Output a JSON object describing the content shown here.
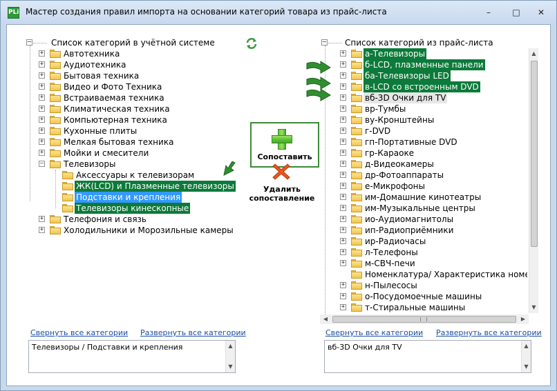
{
  "window": {
    "app_icon": "PLi",
    "title": "Мастер создания правил импорта на основании категорий товара из прайс-листа",
    "controls": {
      "minimize": "–",
      "maximize": "□",
      "close": "✕"
    }
  },
  "left_tree": {
    "root_label": "Список категорий в учётной системе",
    "items": [
      {
        "label": "Автотехника",
        "expander": "+"
      },
      {
        "label": "Аудиотехника",
        "expander": "+"
      },
      {
        "label": "Бытовая техника",
        "expander": "+"
      },
      {
        "label": "Видео и Фото Техника",
        "expander": "+"
      },
      {
        "label": "Встраиваемая техника",
        "expander": "+"
      },
      {
        "label": "Климатическая техника",
        "expander": "+"
      },
      {
        "label": "Компьютерная техника",
        "expander": "+"
      },
      {
        "label": "Кухонные плиты",
        "expander": "+"
      },
      {
        "label": "Мелкая бытовая техника",
        "expander": "+"
      },
      {
        "label": "Мойки и смесители",
        "expander": "+"
      },
      {
        "label": "Телевизоры",
        "expander": "–"
      },
      {
        "label": "Телефония и связь",
        "expander": "+"
      },
      {
        "label": "Холодильники и Морозильные камеры",
        "expander": "+"
      }
    ],
    "children": [
      {
        "label": "Аксессуары к телевизорам",
        "state": "normal"
      },
      {
        "label": "ЖК(LCD) и Плазменные телевизоры",
        "state": "green"
      },
      {
        "label": "Подставки и крепления",
        "state": "blue"
      },
      {
        "label": "Телевизоры кинескопные",
        "state": "green"
      }
    ],
    "collapse_link": "Свернуть все категории",
    "expand_link": "Развернуть все категории",
    "selected_path": "Телевизоры / Подставки и крепления"
  },
  "right_tree": {
    "root_label": "Список категорий из прайс-листа",
    "items": [
      {
        "label": "а-Телевизоры",
        "state": "green",
        "expander": "+"
      },
      {
        "label": "б-LCD, плазменные панели",
        "state": "green",
        "expander": "+"
      },
      {
        "label": "ба-Телевизоры LED",
        "state": "green",
        "expander": "+"
      },
      {
        "label": "в-LCD со встроенным DVD",
        "state": "green",
        "expander": "+"
      },
      {
        "label": "вб-3D Очки для TV",
        "state": "gray",
        "expander": "+"
      },
      {
        "label": "вр-Тумбы",
        "state": "normal",
        "expander": "+"
      },
      {
        "label": "ву-Кронштейны",
        "state": "normal",
        "expander": "+"
      },
      {
        "label": "г-DVD",
        "state": "normal",
        "expander": "+"
      },
      {
        "label": "гп-Портативные DVD",
        "state": "normal",
        "expander": "+"
      },
      {
        "label": "гр-Караоке",
        "state": "normal",
        "expander": "+"
      },
      {
        "label": "д-Видеокамеры",
        "state": "normal",
        "expander": "+"
      },
      {
        "label": "др-Фотоаппараты",
        "state": "normal",
        "expander": "+"
      },
      {
        "label": "е-Микрофоны",
        "state": "normal",
        "expander": "+"
      },
      {
        "label": "им-Домашние кинотеатры",
        "state": "normal",
        "expander": "+"
      },
      {
        "label": "им-Музыкальные центры",
        "state": "normal",
        "expander": "+"
      },
      {
        "label": "ио-Аудиомагнитолы",
        "state": "normal",
        "expander": "+"
      },
      {
        "label": "ип-Радиоприёмники",
        "state": "normal",
        "expander": "+"
      },
      {
        "label": "ир-Радиочасы",
        "state": "normal",
        "expander": "+"
      },
      {
        "label": "л-Телефоны",
        "state": "normal",
        "expander": "+"
      },
      {
        "label": "м-СВЧ-печи",
        "state": "normal",
        "expander": "+"
      },
      {
        "label": "Номенклатура/ Характеристика номенклат",
        "state": "normal",
        "expander": ""
      },
      {
        "label": "н-Пылесосы",
        "state": "normal",
        "expander": "+"
      },
      {
        "label": "о-Посудомоечные машины",
        "state": "normal",
        "expander": "+"
      },
      {
        "label": "т-Стиральные машины",
        "state": "normal",
        "expander": "+"
      }
    ],
    "collapse_link": "Свернуть все категории",
    "expand_link": "Развернуть все категории",
    "selected_path": "вб-3D Очки для TV"
  },
  "actions": {
    "match_label": "Сопоставить",
    "delete_label_line1": "Удалить",
    "delete_label_line2": "сопоставление"
  },
  "colors": {
    "highlight_green": "#0c7a3a",
    "highlight_blue": "#3399ff",
    "accent_green": "#3a8a35",
    "delete_orange": "#e8571e"
  },
  "icons": {
    "refresh": "refresh-icon",
    "plus": "plus-icon",
    "delete": "delete-x-icon",
    "folder": "folder-icon"
  }
}
